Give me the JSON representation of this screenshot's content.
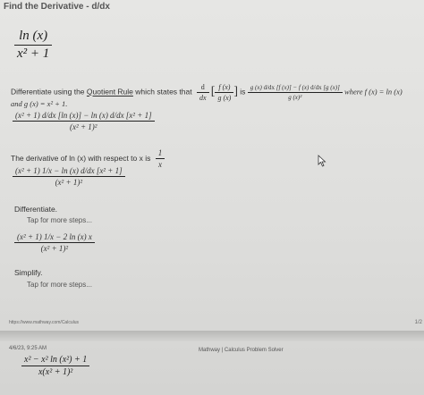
{
  "title": "Find the Derivative - d/dx",
  "problem": {
    "num": "ln (x)",
    "den": "x² + 1"
  },
  "step1": {
    "intro": "Differentiate using the",
    "link": "Quotient Rule",
    "mid": "which states that",
    "is": "is",
    "where": "where f (x) = ln (x)",
    "and": "and g (x) = x² + 1."
  },
  "step1_expr": {
    "num": "(x² + 1) d/dx [ln (x)] − ln (x) d/dx [x² + 1]",
    "den": "(x² + 1)²"
  },
  "step2": {
    "text": "The derivative of ln (x) with respect to x is",
    "value_num": "1",
    "value_den": "x"
  },
  "step2_expr": {
    "num": "(x² + 1) 1/x − ln (x) d/dx [x² + 1]",
    "den": "(x² + 1)²"
  },
  "step3": {
    "label": "Differentiate.",
    "tap": "Tap for more steps..."
  },
  "step3_expr": {
    "num": "(x² + 1) 1/x − 2 ln (x) x",
    "den": "(x² + 1)²"
  },
  "step4": {
    "label": "Simplify.",
    "tap": "Tap for more steps..."
  },
  "footer": {
    "url": "https://www.mathway.com/Calculus",
    "page": "1/2",
    "date": "4/6/23, 9:25 AM",
    "site": "Mathway | Calculus Problem Solver"
  },
  "final": {
    "num": "x² − x² ln (x²) + 1",
    "den": "x(x² + 1)²"
  },
  "colors": {
    "background": "#e6e6e4",
    "text": "#222222"
  },
  "icons": {
    "cursor": "mouse-pointer-icon"
  }
}
